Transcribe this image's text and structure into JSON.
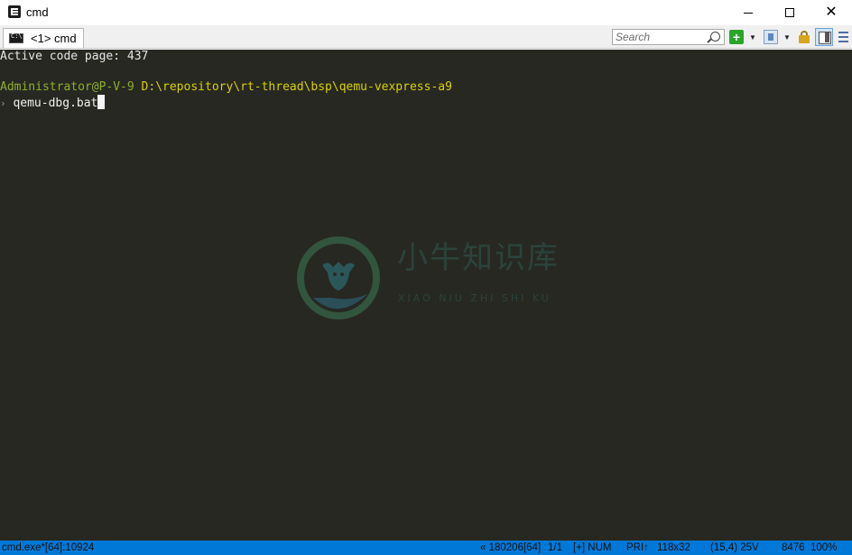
{
  "window": {
    "title": "cmd"
  },
  "tabs": [
    {
      "label": "<1> cmd"
    }
  ],
  "toolbar": {
    "search_placeholder": "Search"
  },
  "console": {
    "line1": "Active code page: 437",
    "prompt_user": "Administrator@P-V-9",
    "prompt_path": "D:\\repository\\rt-thread\\bsp\\qemu-vexpress-a9",
    "prompt_symbol": "›",
    "command": "qemu-dbg.bat"
  },
  "watermark": {
    "title": "小牛知识库",
    "subtitle": "XIAO NIU ZHI SHI KU"
  },
  "statusbar": {
    "process": "cmd.exe*[64]:10924",
    "scroll": "« 180206[64]",
    "pages": "1/1",
    "keys": "[+] NUM",
    "priority": "PRI↑",
    "size": "118x32",
    "cursor": "(15,4) 25V",
    "pid": "8476",
    "zoom": "100%"
  },
  "colors": {
    "console_bg": "#272822",
    "prompt_user": "#8db02a",
    "prompt_path": "#d8d200",
    "statusbar_bg": "#0078d7"
  },
  "icons": [
    "app-icon",
    "console-tab-icon",
    "search-icon",
    "plus-icon",
    "chevron-down-icon",
    "panel-icon",
    "lock-icon",
    "layout-icon",
    "menu-icon"
  ]
}
